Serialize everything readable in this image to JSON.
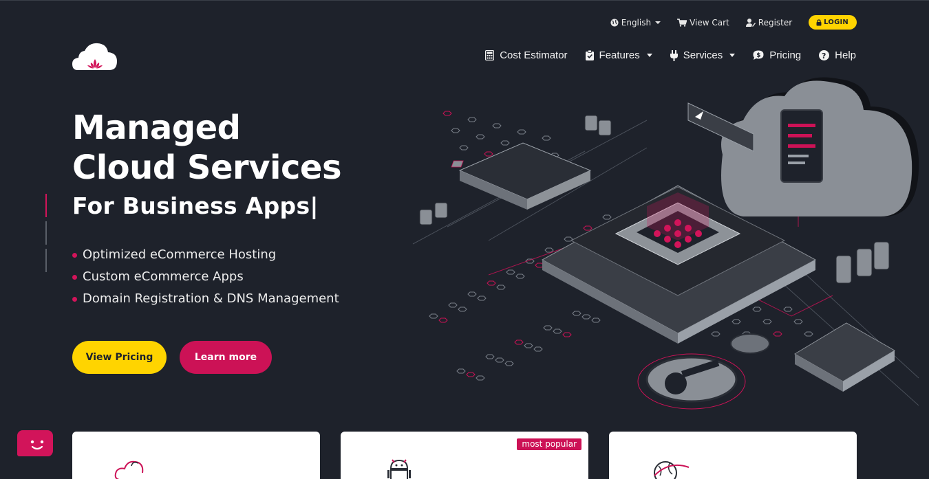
{
  "top_bar": {
    "language": "English",
    "view_cart": "View Cart",
    "register": "Register",
    "login": "LOGIN"
  },
  "nav": {
    "cost_estimator": "Cost Estimator",
    "features": "Features",
    "services": "Services",
    "pricing": "Pricing",
    "help": "Help"
  },
  "hero": {
    "title_line1": "Managed",
    "title_line2": "Cloud Services",
    "subtitle": "For Business Apps|",
    "features": [
      "Optimized eCommerce Hosting",
      "Custom eCommerce Apps",
      "Domain Registration & DNS Management"
    ],
    "primary_button": "View Pricing",
    "secondary_button": "Learn more"
  },
  "cards": [
    {
      "icon": "cloud-icon"
    },
    {
      "icon": "android-icon",
      "badge": "most popular"
    },
    {
      "icon": "globe-icon"
    }
  ],
  "colors": {
    "background": "#1e222b",
    "accent_yellow": "#ffd400",
    "accent_pink": "#cc1256"
  }
}
